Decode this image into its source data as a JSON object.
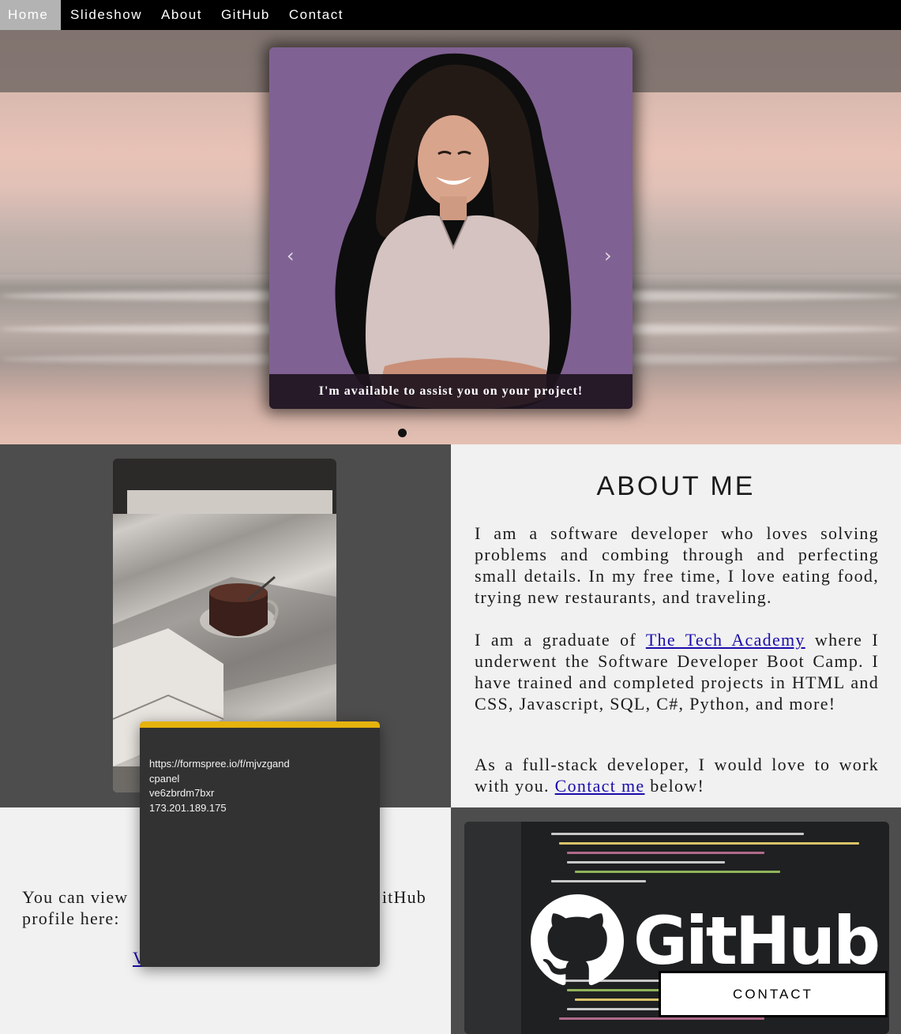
{
  "nav": {
    "items": [
      {
        "label": "Home",
        "active": true
      },
      {
        "label": "Slideshow",
        "active": false
      },
      {
        "label": "About",
        "active": false
      },
      {
        "label": "GitHub",
        "active": false
      },
      {
        "label": "Contact",
        "active": false
      }
    ]
  },
  "slideshow": {
    "caption": "I'm available to assist you on your project!",
    "prev_icon": "‹",
    "next_icon": "›",
    "slide_count": 1,
    "active_slide": 1
  },
  "about": {
    "title": "ABOUT ME",
    "p1": "I am a software developer who loves solving problems and combing through and perfecting small details. In my free time, I love eating food, trying new restaurants, and traveling.",
    "p2_before": "I am a graduate of ",
    "p2_link": "The Tech Academy",
    "p2_after": " where I underwent the Software Developer Boot Camp. I have trained and completed projects in HTML and CSS, Javascript, SQL, C#, Python, and more!",
    "p3_before": "As a full-stack developer, I would love to work with you. ",
    "p3_link": "Contact me",
    "p3_after": " below!"
  },
  "github": {
    "text_visible_start": "You can view",
    "text_visible_end": "itHub",
    "text_line2": "profile here:",
    "link_visible": "V",
    "logo_word": "GitHub"
  },
  "contact_button": {
    "label": "CONTACT"
  },
  "popup": {
    "accent_color": "#e5b30e",
    "lines": [
      "https://formspree.io/f/mjvzgand",
      "cpanel",
      "ve6zbrdm7bxr",
      "173.201.189.175"
    ]
  },
  "colors": {
    "nav_bg": "#000000",
    "nav_active": "#b3b3b3",
    "section_dark": "#4d4d4d",
    "section_light": "#f1f1f1",
    "link": "#1a0dab",
    "slide_bg": "#806193"
  }
}
